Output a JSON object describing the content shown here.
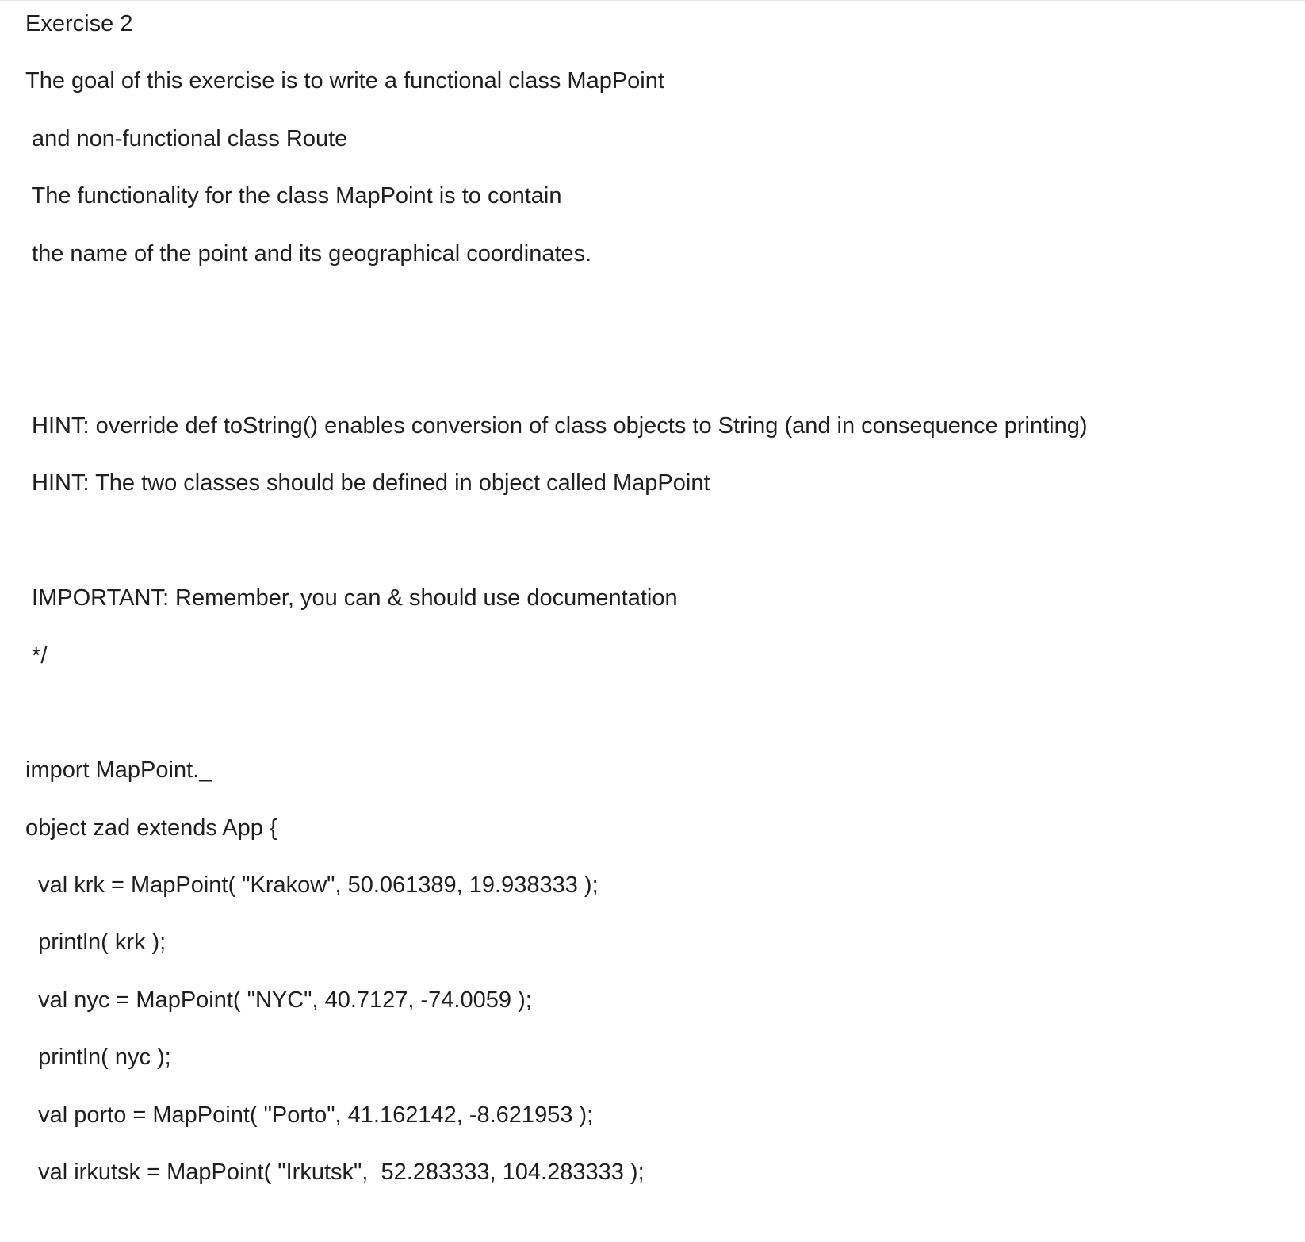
{
  "document": {
    "lines": [
      "Exercise 2",
      "The goal of this exercise is to write a functional class MapPoint",
      " and non-functional class Route",
      " The functionality for the class MapPoint is to contain",
      " the name of the point and its geographical coordinates.",
      " HINT: override def toString() enables conversion of class objects to String (and in consequence printing)",
      " HINT: The two classes should be defined in object called MapPoint",
      " IMPORTANT: Remember, you can & should use documentation",
      " */",
      "import MapPoint._",
      "object zad extends App {",
      "  val krk = MapPoint( \"Krakow\", 50.061389, 19.938333 );",
      "  println( krk );",
      "  val nyc = MapPoint( \"NYC\", 40.7127, -74.0059 );",
      "  println( nyc );",
      "  val porto = MapPoint( \"Porto\", 41.162142, -8.621953 );",
      "  val irkutsk = MapPoint( \"Irkutsk\",  52.283333, 104.283333 );"
    ]
  }
}
